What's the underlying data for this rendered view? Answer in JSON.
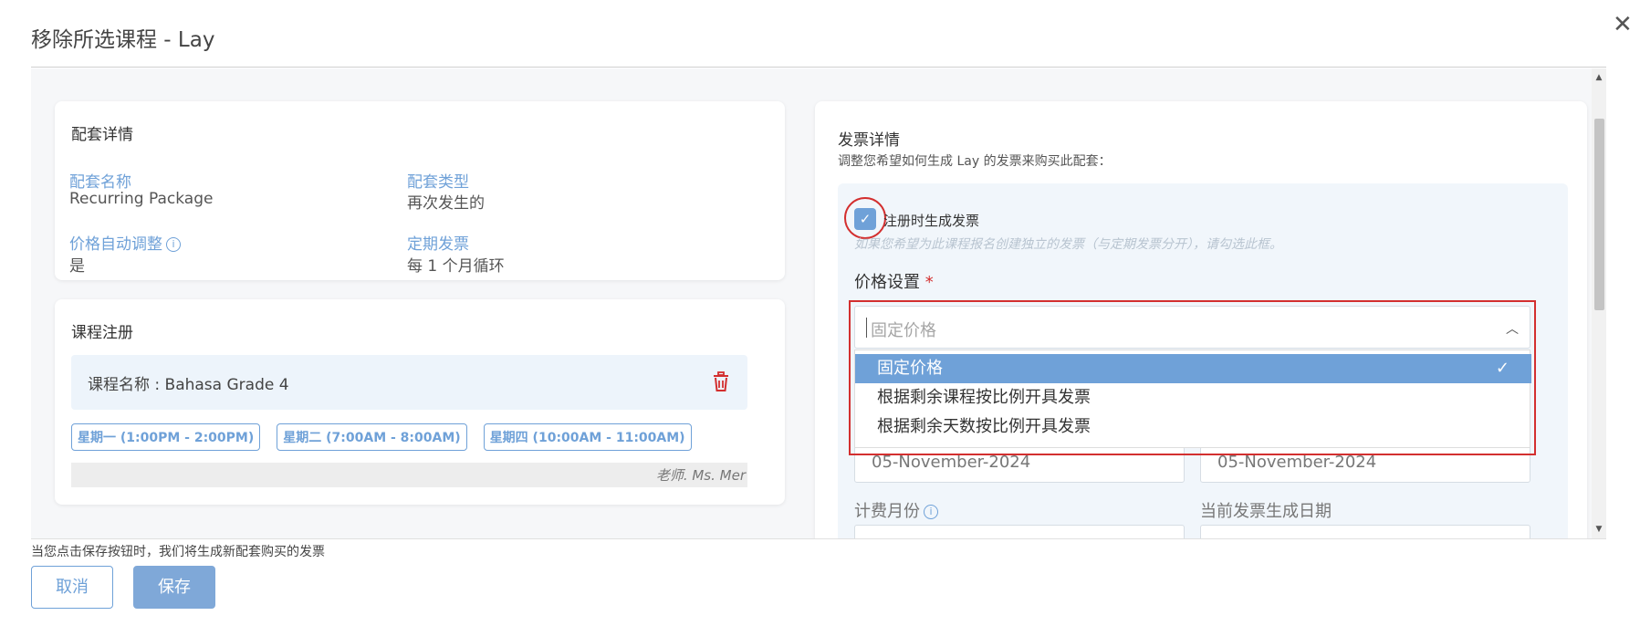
{
  "modal": {
    "title": "移除所选课程 - Lay",
    "close_glyph": "✕"
  },
  "package": {
    "heading": "配套详情",
    "name_label": "配套名称",
    "name_value": "Recurring Package",
    "type_label": "配套类型",
    "type_value": "再次发生的",
    "auto_adjust_label": "价格自动调整",
    "auto_adjust_value": "是",
    "recurring_label": "定期发票",
    "recurring_value": "每 1 个月循环"
  },
  "course": {
    "heading": "课程注册",
    "name": "课程名称 : Bahasa Grade 4",
    "schedule": [
      "星期一 (1:00PM - 2:00PM)",
      "星期二 (7:00AM - 8:00AM)",
      "星期四 (10:00AM - 11:00AM)"
    ],
    "teacher": "老师. Ms. Mer"
  },
  "invoice": {
    "heading": "发票详情",
    "subtitle": "调整您希望如何生成 Lay 的发票来购买此配套：",
    "generate_on_enroll_label": "注册时生成发票",
    "generate_on_enroll_checked": true,
    "hint": "如果您希望为此课程报名创建独立的发票（与定期发票分开），请勾选此框。",
    "price_label": "价格设置",
    "required_mark": "*",
    "price_placeholder": "固定价格",
    "price_options": [
      "固定价格",
      "根据剩余课程按比例开具发票",
      "根据剩余天数按比例开具发票"
    ],
    "selected_option": "固定价格",
    "date_left": "05-November-2024",
    "date_right": "05-November-2024",
    "billing_month_label": "计费月份",
    "current_invoice_date_label": "当前发票生成日期"
  },
  "footer": {
    "note": "当您点击保存按钮时，我们将生成新配套购买的发票",
    "cancel_label": "取消",
    "save_label": "保存"
  },
  "colors": {
    "accent": "#6fa1d8",
    "highlight_red": "#d32f2f",
    "save_button": "#7fa8d8"
  }
}
